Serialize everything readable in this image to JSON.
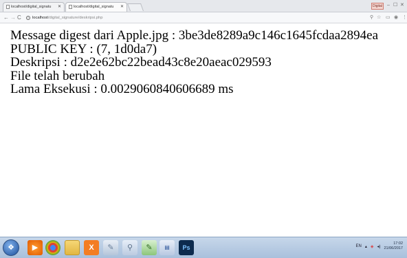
{
  "browser": {
    "tabs": [
      {
        "title": "localhost/digital_signatu"
      },
      {
        "title": "localhost/digital_signatu"
      }
    ],
    "user_label": "Digital",
    "url_host": "localhost",
    "url_path": "/digital_signature/deskripsi.php"
  },
  "page": {
    "lines": [
      "Message digest dari Apple.jpg : 3be3de8289a9c146c1645fcdaa2894ea",
      "PUBLIC KEY : (7, 1d0da7)",
      "Deskripsi : d2e2e62bc22bead43c8e20aeac029593",
      "File telah berubah",
      "Lama Eksekusi : 0.0029060840606689 ms"
    ]
  },
  "taskbar": {
    "apps": [
      "windows-media-player-icon",
      "chrome-icon",
      "file-explorer-icon",
      "xampp-icon",
      "paint-icon",
      "search-magnifier-icon",
      "notepad-plus-icon",
      "word-icon",
      "photoshop-icon"
    ],
    "tray_lang": "EN",
    "clock_time": "17:02",
    "clock_date": "21/06/2017"
  }
}
